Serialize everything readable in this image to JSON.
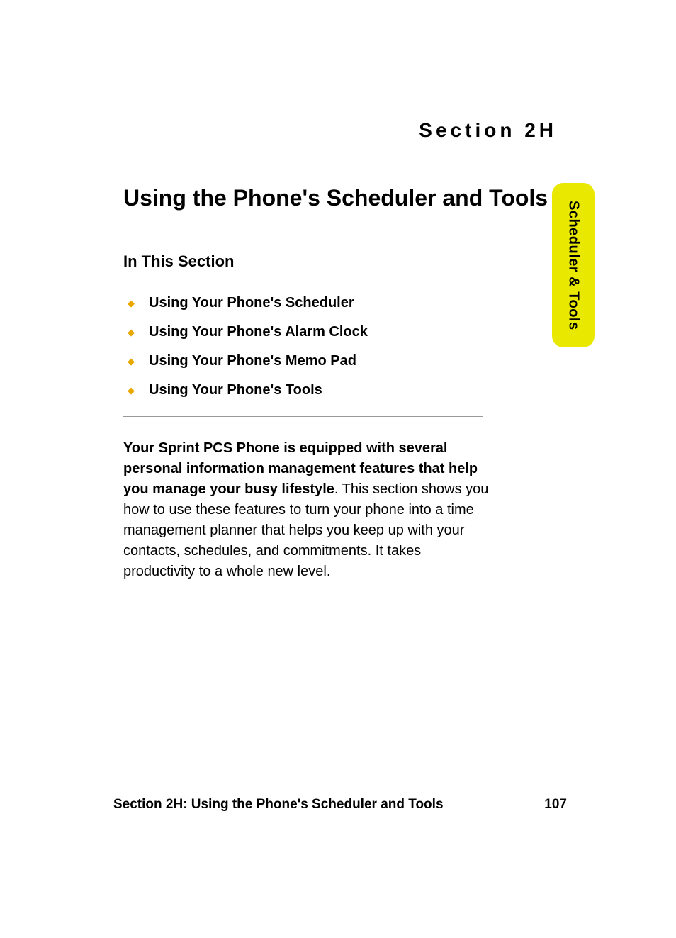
{
  "section_label": "Section 2H",
  "main_title": "Using the Phone's Scheduler and Tools",
  "tab_label": "Scheduler & Tools",
  "subsection_title": "In This Section",
  "toc_items": [
    "Using Your Phone's Scheduler",
    "Using Your Phone's Alarm Clock",
    "Using Your Phone's Memo Pad",
    "Using Your Phone's Tools"
  ],
  "body_bold": "Your Sprint PCS Phone is equipped with several personal information management features that help you manage your busy lifestyle",
  "body_regular": ". This section shows you how to use these features to turn your phone into a time management planner that helps you keep up with your contacts, schedules, and commitments. It takes productivity to a whole new level.",
  "footer_title": "Section 2H: Using the Phone's Scheduler and Tools",
  "page_number": "107"
}
